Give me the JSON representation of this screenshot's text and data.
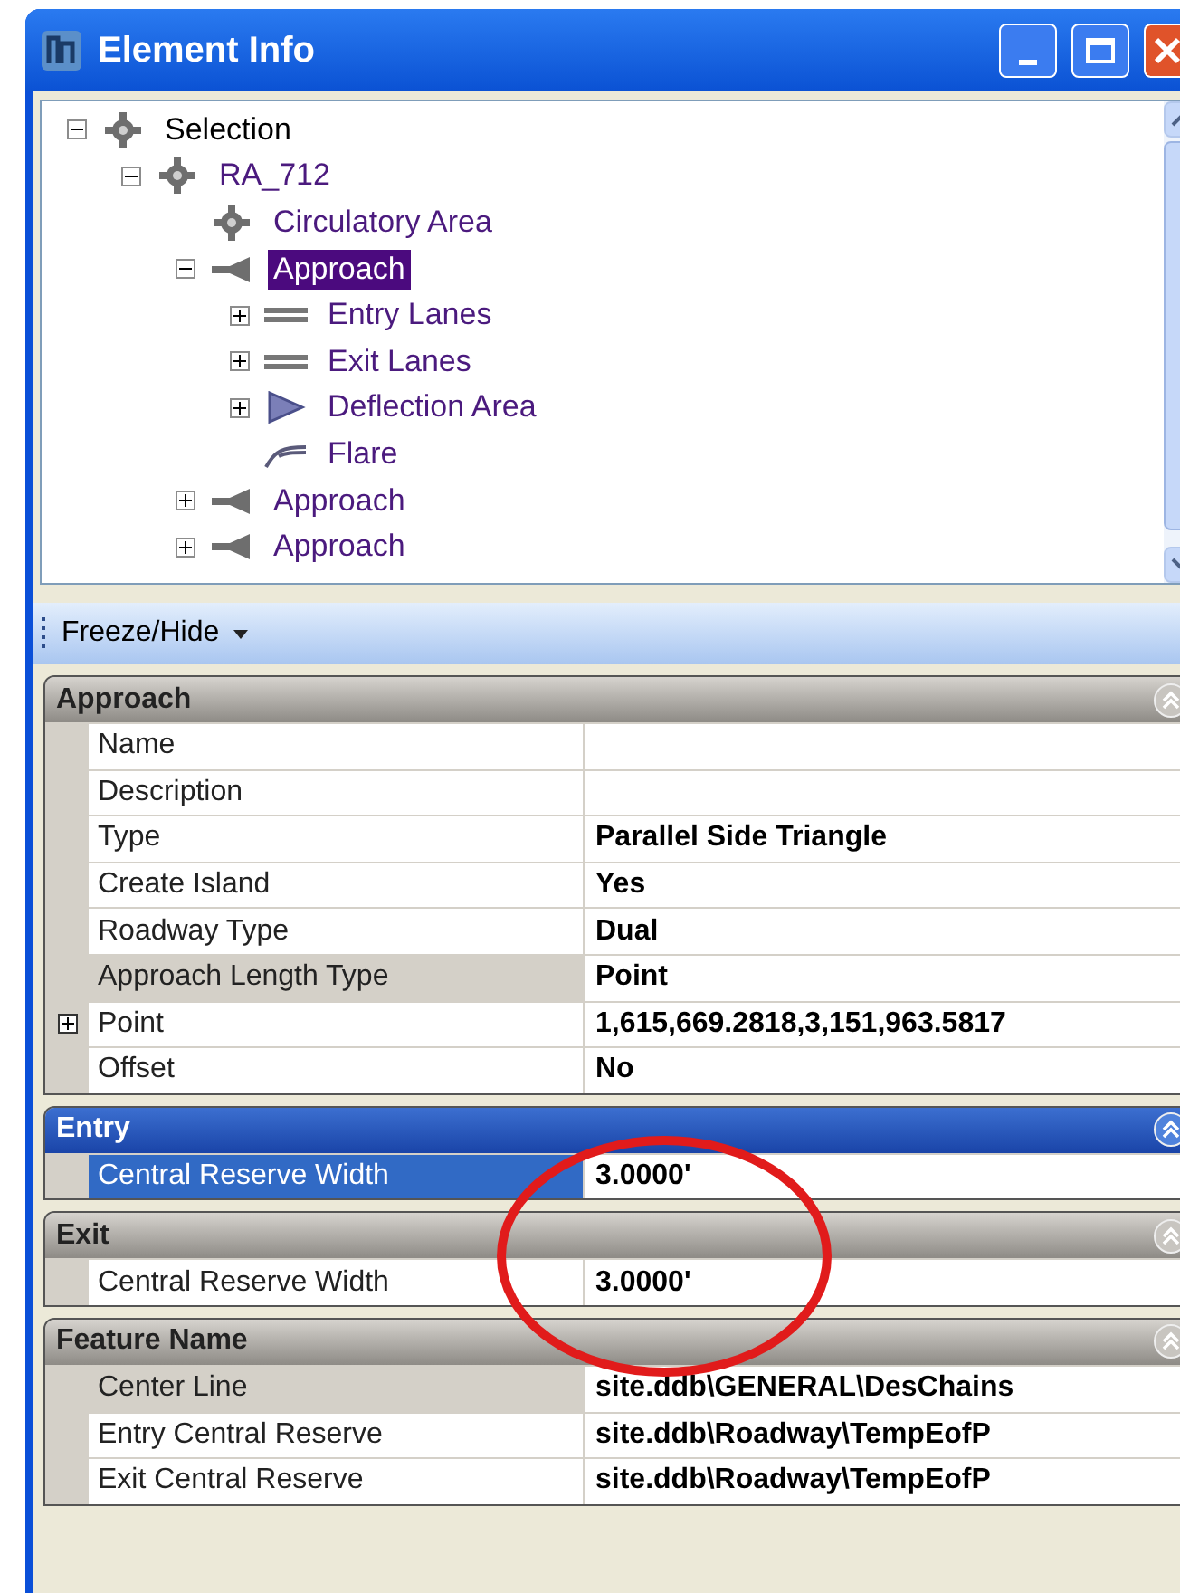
{
  "window": {
    "title": "Element Info"
  },
  "tree": [
    {
      "label": "Selection",
      "kind": "roundabout",
      "expanded": true,
      "selected": false,
      "children": [
        {
          "label": "RA_712",
          "kind": "roundabout",
          "expanded": true,
          "selected": false,
          "children": [
            {
              "label": "Circulatory Area",
              "kind": "roundabout",
              "selected": false
            },
            {
              "label": "Approach",
              "kind": "approach",
              "expanded": true,
              "selected": true,
              "children": [
                {
                  "label": "Entry Lanes",
                  "kind": "lanes",
                  "expanded": false,
                  "selected": false
                },
                {
                  "label": "Exit Lanes",
                  "kind": "lanes",
                  "expanded": false,
                  "selected": false
                },
                {
                  "label": "Deflection Area",
                  "kind": "deflection",
                  "expanded": false,
                  "selected": false
                },
                {
                  "label": "Flare",
                  "kind": "flare",
                  "selected": false
                }
              ]
            },
            {
              "label": "Approach",
              "kind": "approach",
              "expanded": false,
              "selected": false
            },
            {
              "label": "Approach",
              "kind": "approach",
              "expanded": false,
              "selected": false
            }
          ]
        }
      ]
    }
  ],
  "toolbar": {
    "menu": "Freeze/Hide"
  },
  "sections": [
    {
      "title": "Approach",
      "active": false,
      "rows": [
        {
          "label": "Name",
          "value": "",
          "selected": false,
          "highlighted": false
        },
        {
          "label": "Description",
          "value": "",
          "selected": false,
          "highlighted": false
        },
        {
          "label": "Type",
          "value": "Parallel Side Triangle",
          "selected": false,
          "highlighted": false
        },
        {
          "label": "Create Island",
          "value": "Yes",
          "selected": false,
          "highlighted": false
        },
        {
          "label": "Roadway Type",
          "value": "Dual",
          "selected": false,
          "highlighted": false
        },
        {
          "label": "Approach Length Type",
          "value": "Point",
          "selected": false,
          "highlighted": true
        },
        {
          "label": "Point",
          "value": "1,615,669.2818,3,151,963.5817",
          "selected": false,
          "highlighted": false,
          "expanded": false
        },
        {
          "label": "Offset",
          "value": "No",
          "selected": false,
          "highlighted": false
        }
      ]
    },
    {
      "title": "Entry",
      "active": true,
      "rows": [
        {
          "label": "Central Reserve Width",
          "value": "3.0000'",
          "selected": true,
          "highlighted": false
        }
      ]
    },
    {
      "title": "Exit",
      "active": false,
      "rows": [
        {
          "label": "Central Reserve Width",
          "value": "3.0000'",
          "selected": false,
          "highlighted": false
        }
      ]
    },
    {
      "title": "Feature Name",
      "active": false,
      "rows": [
        {
          "label": "Center Line",
          "value": "site.ddb\\GENERAL\\DesChains",
          "selected": false,
          "highlighted": true
        },
        {
          "label": "Entry Central Reserve",
          "value": "site.ddb\\Roadway\\TempEofP",
          "selected": false,
          "highlighted": false
        },
        {
          "label": "Exit Central Reserve",
          "value": "site.ddb\\Roadway\\TempEofP",
          "selected": false,
          "highlighted": false
        }
      ]
    }
  ]
}
